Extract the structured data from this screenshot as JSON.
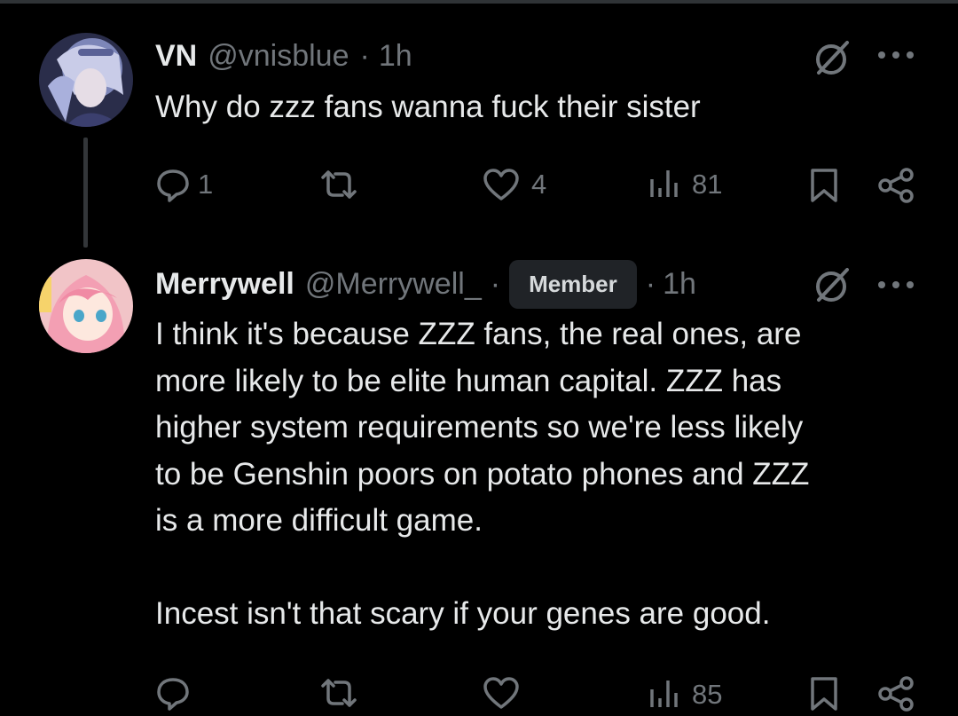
{
  "post": {
    "name": "VN",
    "handle": "@vnisblue",
    "sep": "·",
    "time": "1h",
    "text": "Why do zzz fans wanna fuck their sister",
    "replies": "1",
    "likes": "4",
    "views": "81",
    "avatar_icon": "anime-avatar-silver-hair"
  },
  "reply": {
    "name": "Merrywell",
    "handle": "@Merrywell_",
    "sep1": "·",
    "badge": "Member",
    "sep2": "·",
    "time": "1h",
    "lines": [
      "I think it's because ZZZ fans, the real ones, are",
      "more likely to be elite human capital. ZZZ has",
      "higher system requirements so we're less likely",
      "to be Genshin poors on potato phones and ZZZ",
      "is a more difficult game.",
      "",
      "Incest isn't that scary if your genes are good."
    ],
    "views": "85",
    "avatar_icon": "anime-avatar-pink-hair"
  },
  "colors": {
    "background": "#000000",
    "text": "#e7e9ea",
    "muted": "#71767b",
    "badge_bg": "#202327"
  }
}
